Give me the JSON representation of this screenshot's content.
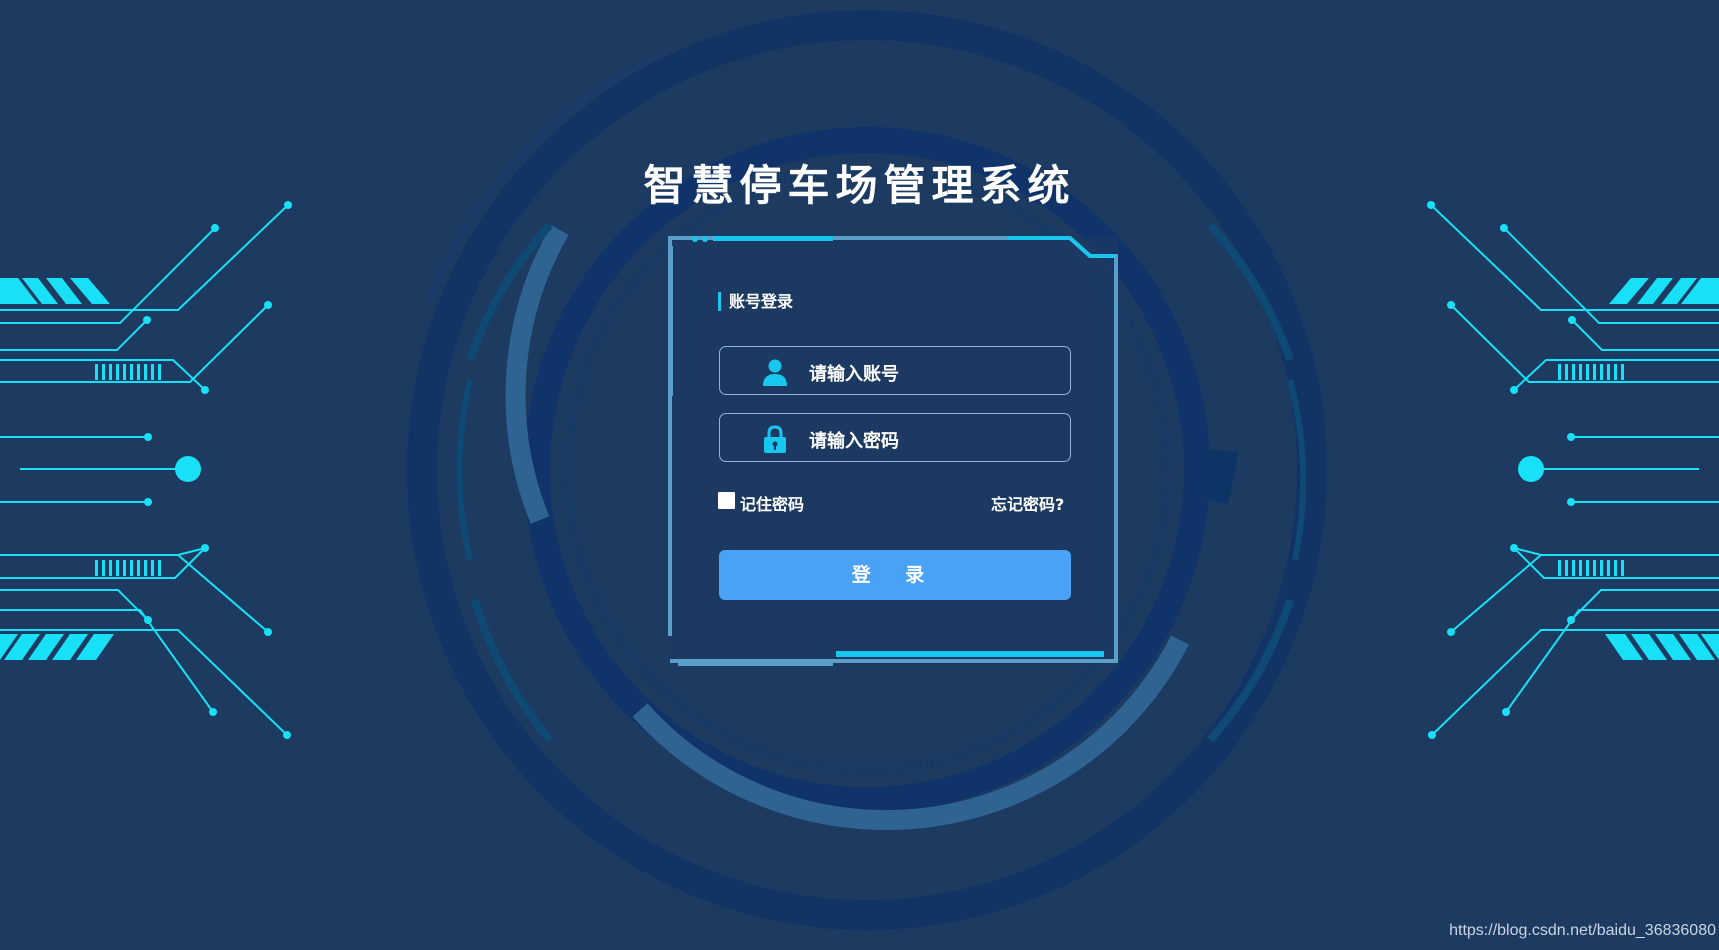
{
  "app": {
    "title": "智慧停车场管理系统"
  },
  "login": {
    "heading": "账号登录",
    "username_placeholder": "请输入账号",
    "password_placeholder": "请输入密码",
    "remember_label": "记住密码",
    "forgot_label": "忘记密码?",
    "submit_label": "登 录"
  },
  "footer": {
    "watermark": "https://blog.csdn.net/baidu_36836080"
  },
  "colors": {
    "background": "#1d3a61",
    "accent_cyan": "#18e0f7",
    "button": "#4aa2f7",
    "frame": "#5b9fc9"
  },
  "icons": {
    "username": "user-icon",
    "password": "lock-icon",
    "remember": "checkbox-icon"
  }
}
